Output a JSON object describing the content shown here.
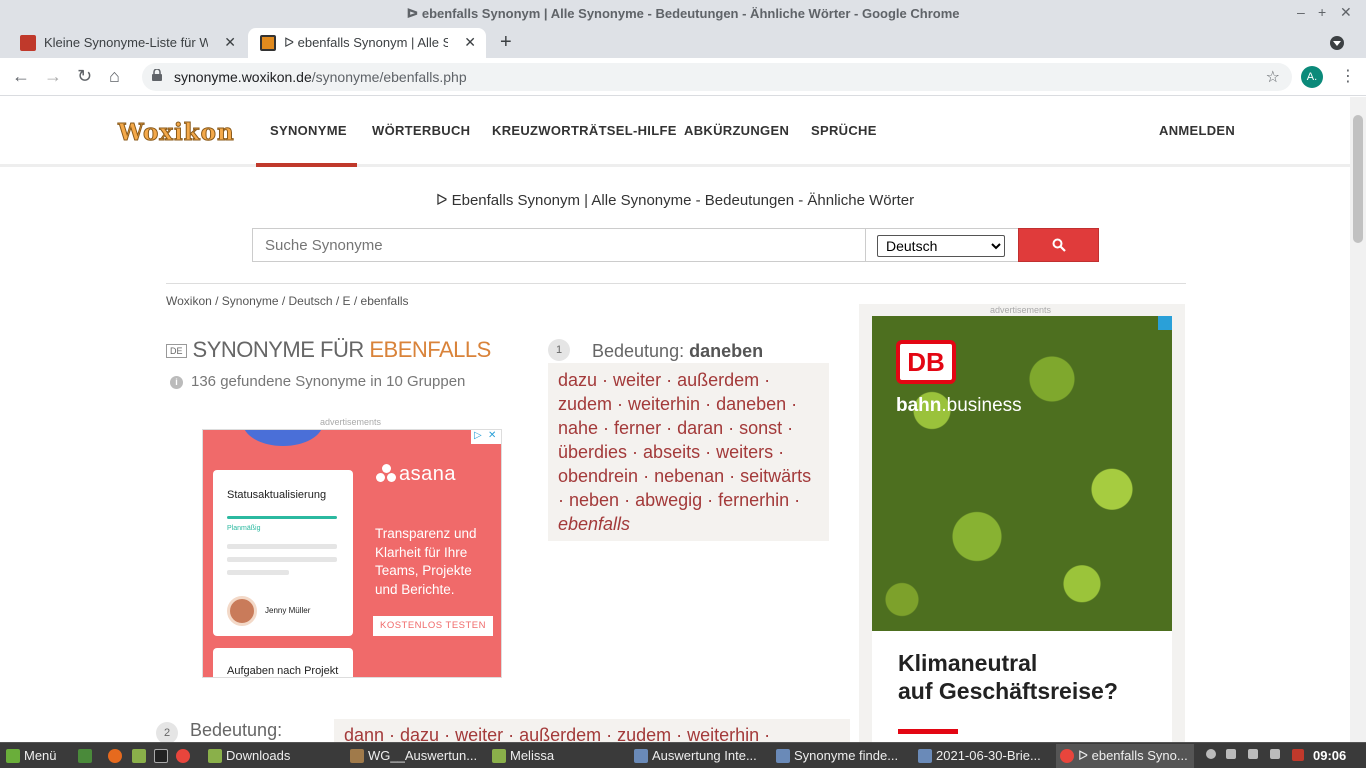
{
  "window": {
    "title": "ᐅ ebenfalls Synonym | Alle Synonyme - Bedeutungen - Ähnliche Wörter - Google Chrome"
  },
  "tabs": [
    {
      "label": "Kleine Synonyme-Liste für Werbe",
      "active": false
    },
    {
      "label": "ᐅ ebenfalls Synonym | Alle Synon",
      "active": true
    }
  ],
  "address": {
    "domain": "synonyme.woxikon.de",
    "path": "/synonyme/ebenfalls.php",
    "profile_initial": "A."
  },
  "site": {
    "logo": "Woxikon",
    "nav": [
      "SYNONYME",
      "WÖRTERBUCH",
      "KREUZWORTRÄTSEL-HILFE",
      "ABKÜRZUNGEN",
      "SPRÜCHE"
    ],
    "login": "ANMELDEN",
    "page_title": "ᐅ Ebenfalls Synonym | Alle Synonyme - Bedeutungen - Ähnliche Wörter",
    "search_placeholder": "Suche Synonyme",
    "language": "Deutsch",
    "breadcrumb": "Woxikon / Synonyme / Deutsch / E / ebenfalls",
    "lang_badge": "DE",
    "heading_prefix": "SYNONYME FÜR ",
    "heading_word": "EBENFALLS",
    "found_text": "136 gefundene Synonyme in 10 Gruppen",
    "ad_label": "advertisements"
  },
  "asana_ad": {
    "card1_title": "Statusaktualisierung",
    "card1_status": "Planmäßig",
    "person": "Jenny Müller",
    "card2_title": "Aufgaben nach Projekt",
    "brand": "asana",
    "text": "Transparenz und Klarheit für Ihre Teams, Projekte und Berichte.",
    "cta": "KOSTENLOS TESTEN"
  },
  "db_ad": {
    "logo": "DB",
    "bahn_bold": "bahn",
    "bahn_rest": ".business",
    "headline_1": "Klimaneutral",
    "headline_2": "auf Geschäftsreise?"
  },
  "groups": [
    {
      "number": "1",
      "label": "Bedeutung: ",
      "meaning": "daneben",
      "words": [
        "dazu",
        "weiter",
        "außerdem",
        "zudem",
        "weiterhin",
        "daneben",
        "nahe",
        "ferner",
        "daran",
        "sonst",
        "überdies",
        "abseits",
        "weiters",
        "obendrein",
        "nebenan",
        "seitwärts",
        "neben",
        "abwegig",
        "fernerhin",
        "ebenfalls"
      ]
    },
    {
      "number": "2",
      "label": "Bedeutung:",
      "words_text": "dann · dazu · weiter · außerdem · zudem · weiterhin ·"
    }
  ],
  "taskbar": {
    "menu": "Menü",
    "items": [
      "Downloads",
      "WG__Auswertun...",
      "Melissa",
      "Auswertung Inte...",
      "Synonyme finde...",
      "2021-06-30-Brie...",
      "ebenfalls Syno..."
    ],
    "clock": "09:06"
  }
}
